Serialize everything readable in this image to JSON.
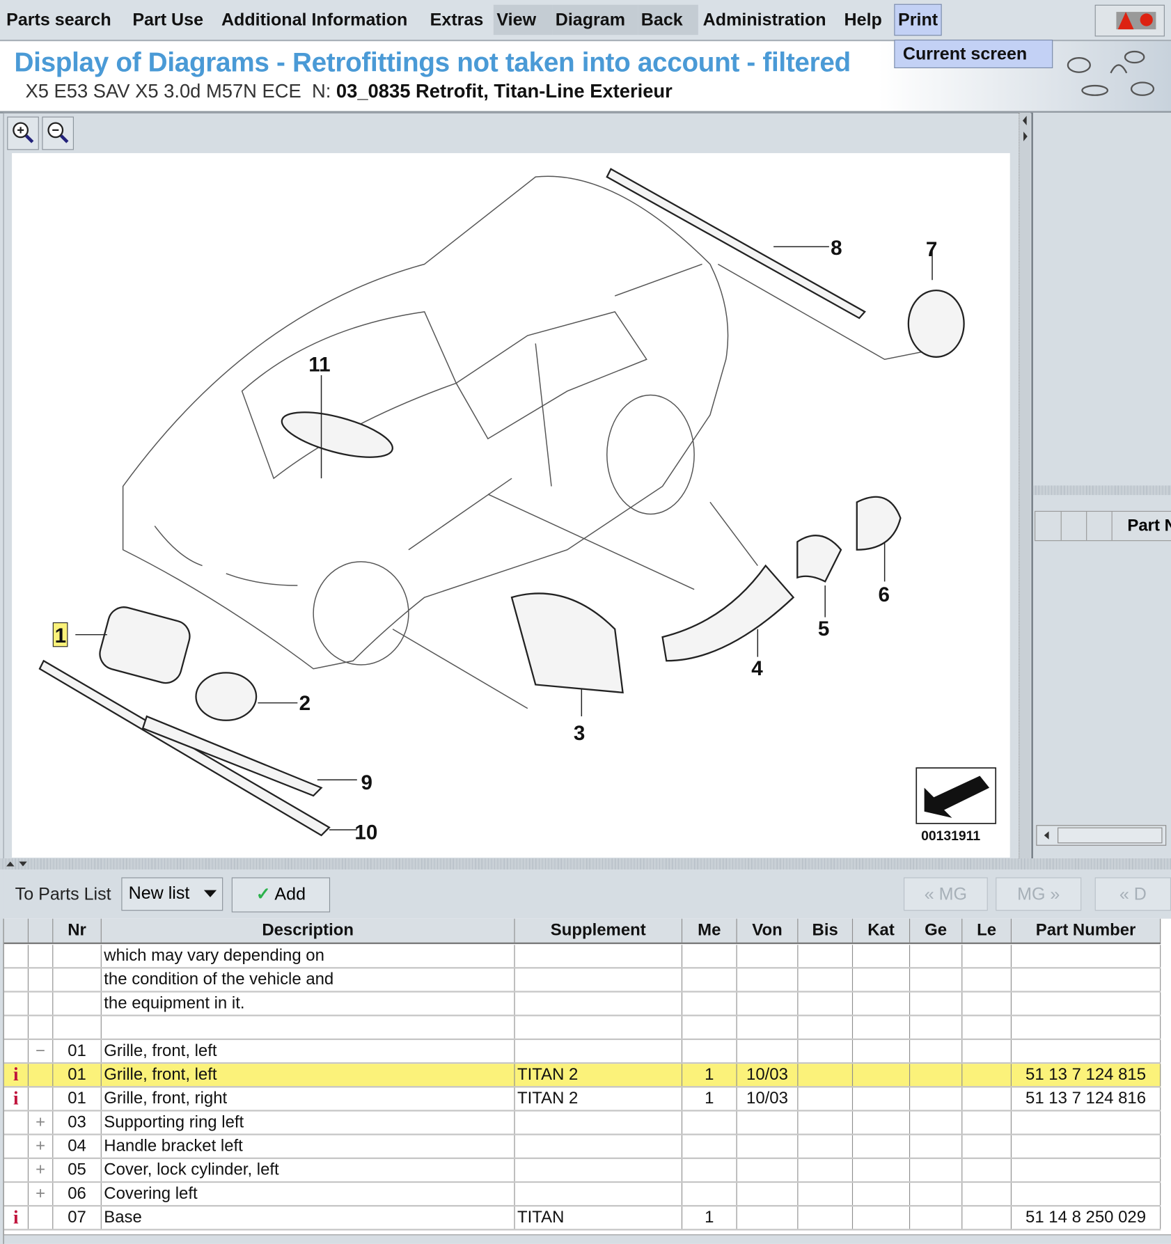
{
  "menu": {
    "items": [
      "Parts search",
      "Part Use",
      "Additional Information",
      "Extras",
      "View",
      "Diagram",
      "Back",
      "Administration",
      "Help",
      "Print"
    ],
    "print_dropdown": [
      "Current screen"
    ]
  },
  "header": {
    "title": "Display of Diagrams - Retrofittings not taken into account - filtered",
    "vehicle": "X5 E53 SAV X5 3.0d M57N ECE",
    "n_label": "N:",
    "group": "03_0835 Retrofit, Titan-Line Exterieur"
  },
  "diagram": {
    "callouts": [
      "1",
      "2",
      "3",
      "4",
      "5",
      "6",
      "7",
      "8",
      "9",
      "10",
      "11"
    ],
    "highlighted_callout": "1",
    "image_number": "00131911"
  },
  "right_panel": {
    "column_header": "Part N"
  },
  "toolbar": {
    "to_parts_list": "To Parts List",
    "list_select": "New list",
    "add": "Add",
    "prev_mg": "« MG",
    "next_mg": "MG »",
    "prev_d": "« D"
  },
  "table": {
    "columns": [
      "",
      "",
      "Nr",
      "Description",
      "Supplement",
      "Me",
      "Von",
      "Bis",
      "Kat",
      "Ge",
      "Le",
      "Part Number"
    ],
    "rows": [
      {
        "i": "",
        "exp": "",
        "nr": "",
        "desc": "which may vary depending on",
        "supp": "",
        "me": "",
        "von": "",
        "bis": "",
        "kat": "",
        "ge": "",
        "le": "",
        "pn": ""
      },
      {
        "i": "",
        "exp": "",
        "nr": "",
        "desc": "the condition of the vehicle and",
        "supp": "",
        "me": "",
        "von": "",
        "bis": "",
        "kat": "",
        "ge": "",
        "le": "",
        "pn": ""
      },
      {
        "i": "",
        "exp": "",
        "nr": "",
        "desc": "the equipment in it.",
        "supp": "",
        "me": "",
        "von": "",
        "bis": "",
        "kat": "",
        "ge": "",
        "le": "",
        "pn": ""
      },
      {
        "i": "",
        "exp": "",
        "nr": "",
        "desc": "",
        "supp": "",
        "me": "",
        "von": "",
        "bis": "",
        "kat": "",
        "ge": "",
        "le": "",
        "pn": ""
      },
      {
        "i": "",
        "exp": "−",
        "nr": "01",
        "desc": "Grille, front, left",
        "supp": "",
        "me": "",
        "von": "",
        "bis": "",
        "kat": "",
        "ge": "",
        "le": "",
        "pn": ""
      },
      {
        "i": "i",
        "exp": "",
        "nr": "01",
        "desc": "Grille, front, left",
        "supp": "TITAN 2",
        "me": "1",
        "von": "10/03",
        "bis": "",
        "kat": "",
        "ge": "",
        "le": "",
        "pn": "51 13 7 124 815",
        "selected": true
      },
      {
        "i": "i",
        "exp": "",
        "nr": "01",
        "desc": "Grille, front, right",
        "supp": "TITAN 2",
        "me": "1",
        "von": "10/03",
        "bis": "",
        "kat": "",
        "ge": "",
        "le": "",
        "pn": "51 13 7 124 816"
      },
      {
        "i": "",
        "exp": "+",
        "nr": "03",
        "desc": "Supporting ring left",
        "supp": "",
        "me": "",
        "von": "",
        "bis": "",
        "kat": "",
        "ge": "",
        "le": "",
        "pn": ""
      },
      {
        "i": "",
        "exp": "+",
        "nr": "04",
        "desc": "Handle bracket left",
        "supp": "",
        "me": "",
        "von": "",
        "bis": "",
        "kat": "",
        "ge": "",
        "le": "",
        "pn": ""
      },
      {
        "i": "",
        "exp": "+",
        "nr": "05",
        "desc": "Cover, lock cylinder, left",
        "supp": "",
        "me": "",
        "von": "",
        "bis": "",
        "kat": "",
        "ge": "",
        "le": "",
        "pn": ""
      },
      {
        "i": "",
        "exp": "+",
        "nr": "06",
        "desc": "Covering left",
        "supp": "",
        "me": "",
        "von": "",
        "bis": "",
        "kat": "",
        "ge": "",
        "le": "",
        "pn": ""
      },
      {
        "i": "i",
        "exp": "",
        "nr": "07",
        "desc": "Base",
        "supp": "TITAN",
        "me": "1",
        "von": "",
        "bis": "",
        "kat": "",
        "ge": "",
        "le": "",
        "pn": "51 14 8 250 029"
      }
    ]
  },
  "colors": {
    "title": "#4a9ad6",
    "selected_row": "#fbf27a",
    "info_icon": "#c0143c",
    "menu_active": "#c3d1f5"
  }
}
